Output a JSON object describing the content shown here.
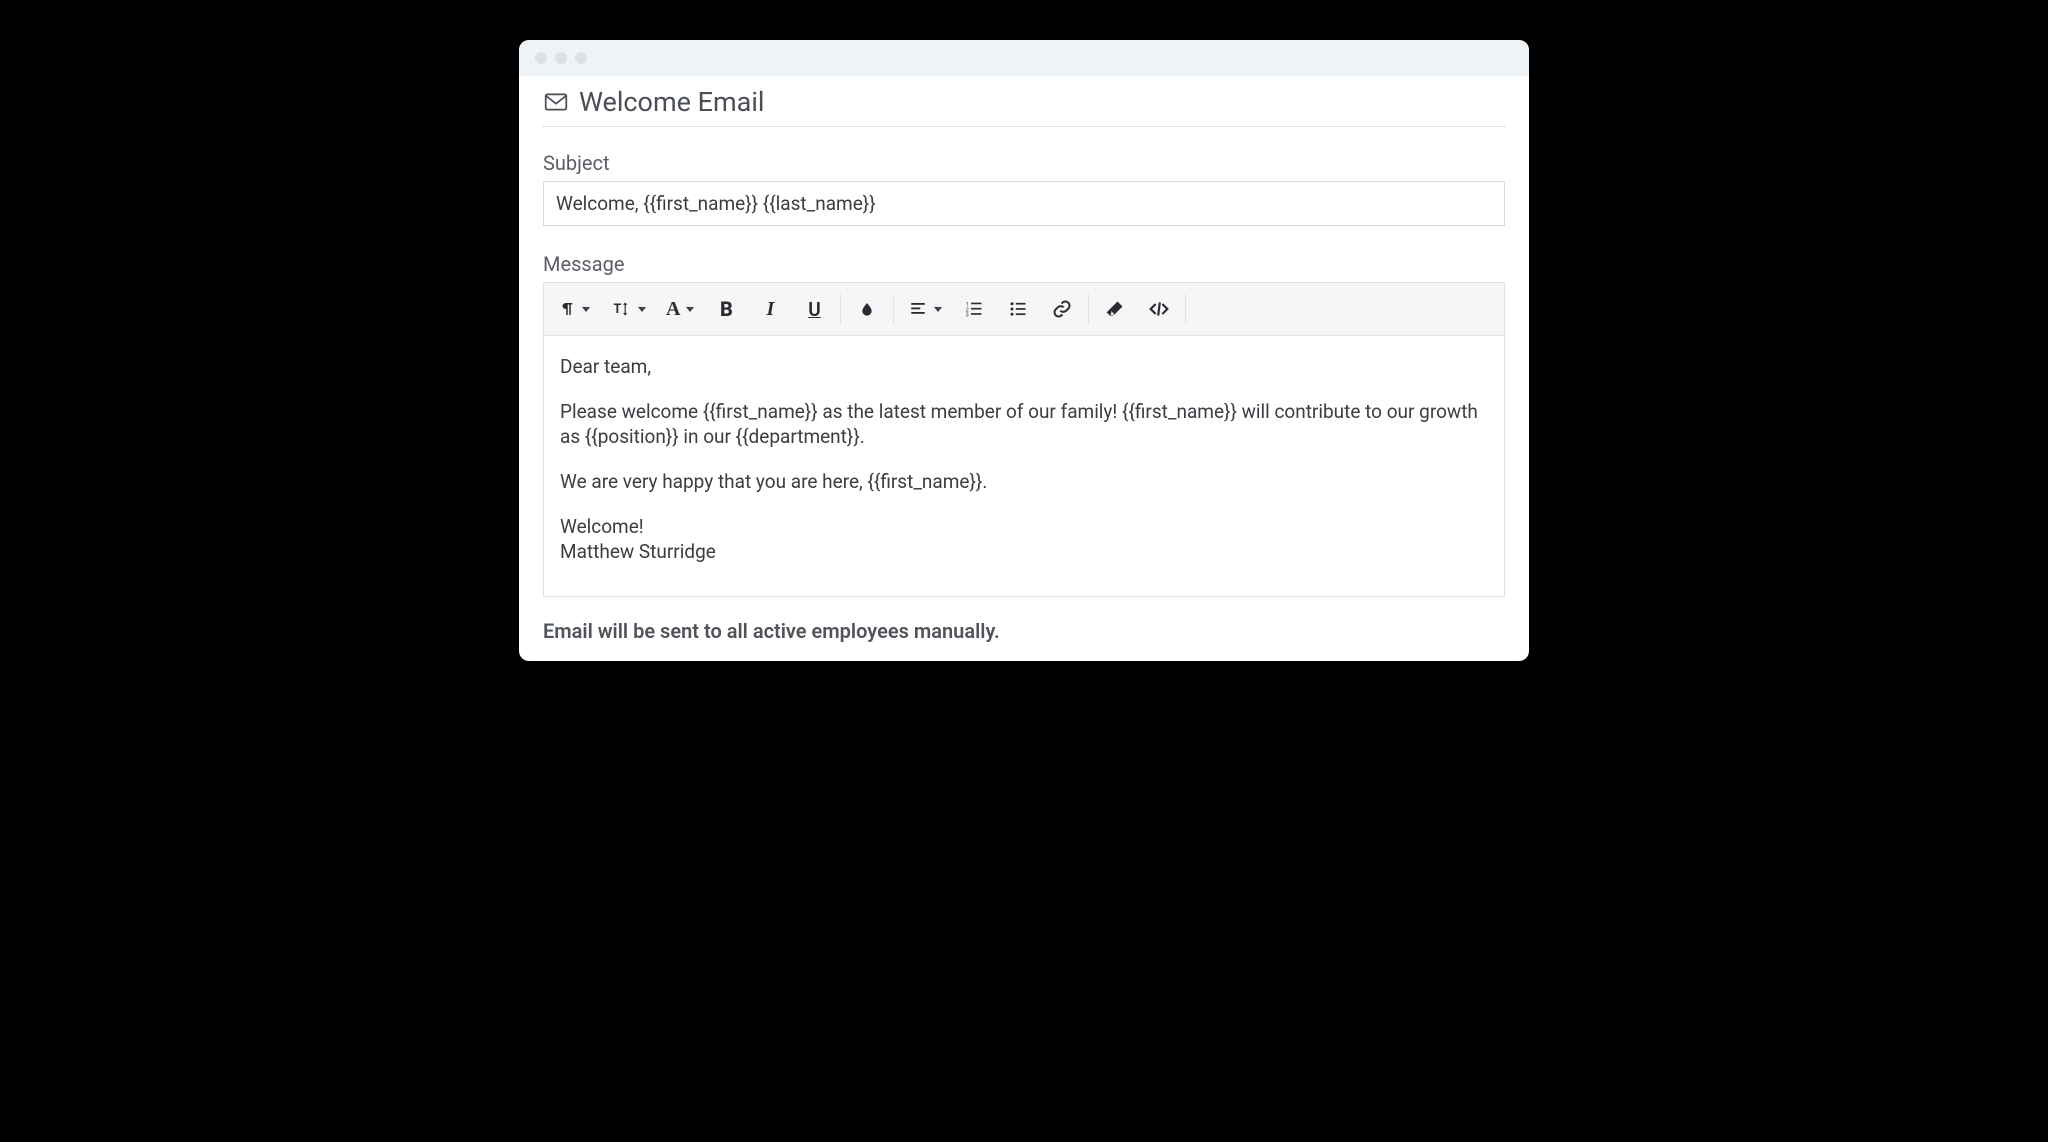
{
  "page": {
    "title": "Welcome Email"
  },
  "subject": {
    "label": "Subject",
    "value": "Welcome, {{first_name}} {{last_name}}"
  },
  "message": {
    "label": "Message",
    "body": {
      "p1": "Dear team,",
      "p2": "Please welcome {{first_name}} as the latest member of our family! {{first_name}} will contribute to our growth as {{position}} in our {{department}}.",
      "p3": "We are very happy that you are here, {{first_name}}.",
      "p4": "Welcome!",
      "p5": "Matthew Sturridge"
    }
  },
  "toolbar": {
    "paragraph": "paragraph-format",
    "lineheight": "line-height",
    "font": "font-family",
    "bold": "bold",
    "italic": "italic",
    "underline": "underline",
    "color": "text-color",
    "align": "align",
    "ol": "ordered-list",
    "ul": "unordered-list",
    "link": "insert-link",
    "clear": "clear-formatting",
    "code": "code-view"
  },
  "note": "Email will be sent to all active employees manually."
}
